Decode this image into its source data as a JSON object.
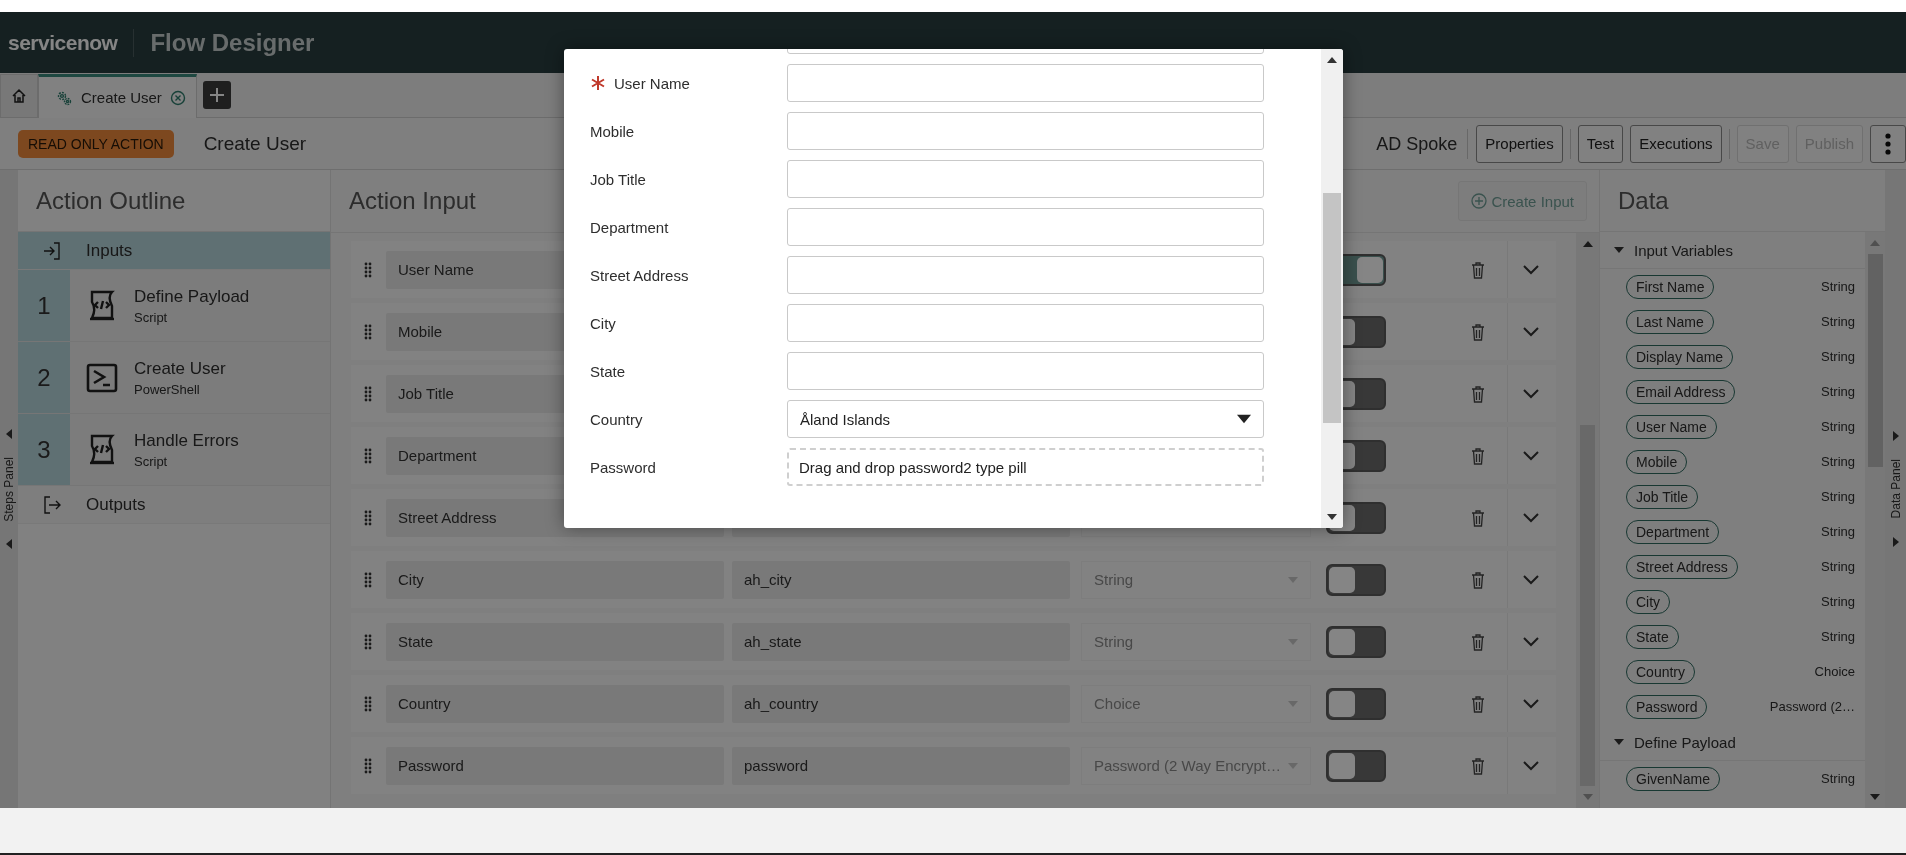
{
  "header": {
    "logo": "servicenow",
    "title": "Flow Designer"
  },
  "tabs": [
    {
      "kind": "home",
      "selected": false
    },
    {
      "kind": "action",
      "label": "Create User",
      "selected": true
    }
  ],
  "toolbar": {
    "badge": "READ ONLY ACTION",
    "title": "Create User",
    "spoke": "AD Spoke",
    "buttons": [
      {
        "label": "Properties",
        "disabled": false
      },
      {
        "label": "Test",
        "disabled": false
      },
      {
        "label": "Executions",
        "disabled": false
      },
      {
        "label": "Save",
        "disabled": true
      },
      {
        "label": "Publish",
        "disabled": true
      }
    ]
  },
  "steps_panel": {
    "label": "Steps Panel"
  },
  "outline": {
    "title": "Action Outline",
    "items": [
      {
        "kind": "inputs",
        "label": "Inputs",
        "selected": true
      },
      {
        "kind": "script",
        "number": "1",
        "label": "Define Payload",
        "sublabel": "Script",
        "selected": false
      },
      {
        "kind": "powershell",
        "number": "2",
        "label": "Create User",
        "sublabel": "PowerShell",
        "selected": false
      },
      {
        "kind": "script",
        "number": "3",
        "label": "Handle Errors",
        "sublabel": "Script",
        "selected": false
      },
      {
        "kind": "outputs",
        "label": "Outputs",
        "selected": false
      }
    ]
  },
  "action_input": {
    "title": "Action Input",
    "create_button": {
      "label": "Create Input",
      "disabled": true
    },
    "rows": [
      {
        "label": "User Name",
        "mandatory": true
      },
      {
        "label": "Mobile",
        "mandatory": false
      },
      {
        "label": "Job Title",
        "mandatory": false
      },
      {
        "label": "Department",
        "mandatory": false
      },
      {
        "label": "Street Address",
        "mandatory": false
      },
      {
        "label": "City",
        "name": "ah_city",
        "type": "String",
        "mandatory": false
      },
      {
        "label": "State",
        "name": "ah_state",
        "type": "String",
        "mandatory": false
      },
      {
        "label": "Country",
        "name": "ah_country",
        "type": "Choice",
        "mandatory": false
      },
      {
        "label": "Password",
        "name": "password",
        "type": "Password (2 Way Encrypt…",
        "mandatory": false
      }
    ]
  },
  "data_panel": {
    "title": "Data",
    "side_label": "Data Panel",
    "sections": [
      {
        "title": "Input Variables",
        "expanded": true,
        "items": [
          {
            "pill": "First Name",
            "type": "String"
          },
          {
            "pill": "Last Name",
            "type": "String"
          },
          {
            "pill": "Display Name",
            "type": "String"
          },
          {
            "pill": "Email Address",
            "type": "String"
          },
          {
            "pill": "User Name",
            "type": "String"
          },
          {
            "pill": "Mobile",
            "type": "String"
          },
          {
            "pill": "Job Title",
            "type": "String"
          },
          {
            "pill": "Department",
            "type": "String"
          },
          {
            "pill": "Street Address",
            "type": "String"
          },
          {
            "pill": "City",
            "type": "String"
          },
          {
            "pill": "State",
            "type": "String"
          },
          {
            "pill": "Country",
            "type": "Choice"
          },
          {
            "pill": "Password",
            "type": "Password (2…"
          }
        ]
      },
      {
        "title": "Define Payload",
        "expanded": true,
        "items": [
          {
            "pill": "GivenName",
            "type": "String"
          }
        ]
      }
    ]
  },
  "modal": {
    "fields": [
      {
        "kind": "text",
        "label": "User Name",
        "required": true
      },
      {
        "kind": "text",
        "label": "Mobile",
        "required": false
      },
      {
        "kind": "text",
        "label": "Job Title",
        "required": false
      },
      {
        "kind": "text",
        "label": "Department",
        "required": false
      },
      {
        "kind": "text",
        "label": "Street Address",
        "required": false
      },
      {
        "kind": "text",
        "label": "City",
        "required": false
      },
      {
        "kind": "text",
        "label": "State",
        "required": false
      },
      {
        "kind": "select",
        "label": "Country",
        "value": "Åland Islands",
        "required": false
      },
      {
        "kind": "pill_drop",
        "label": "Password",
        "placeholder": "Drag and drop password2 type pill",
        "required": false
      }
    ]
  }
}
